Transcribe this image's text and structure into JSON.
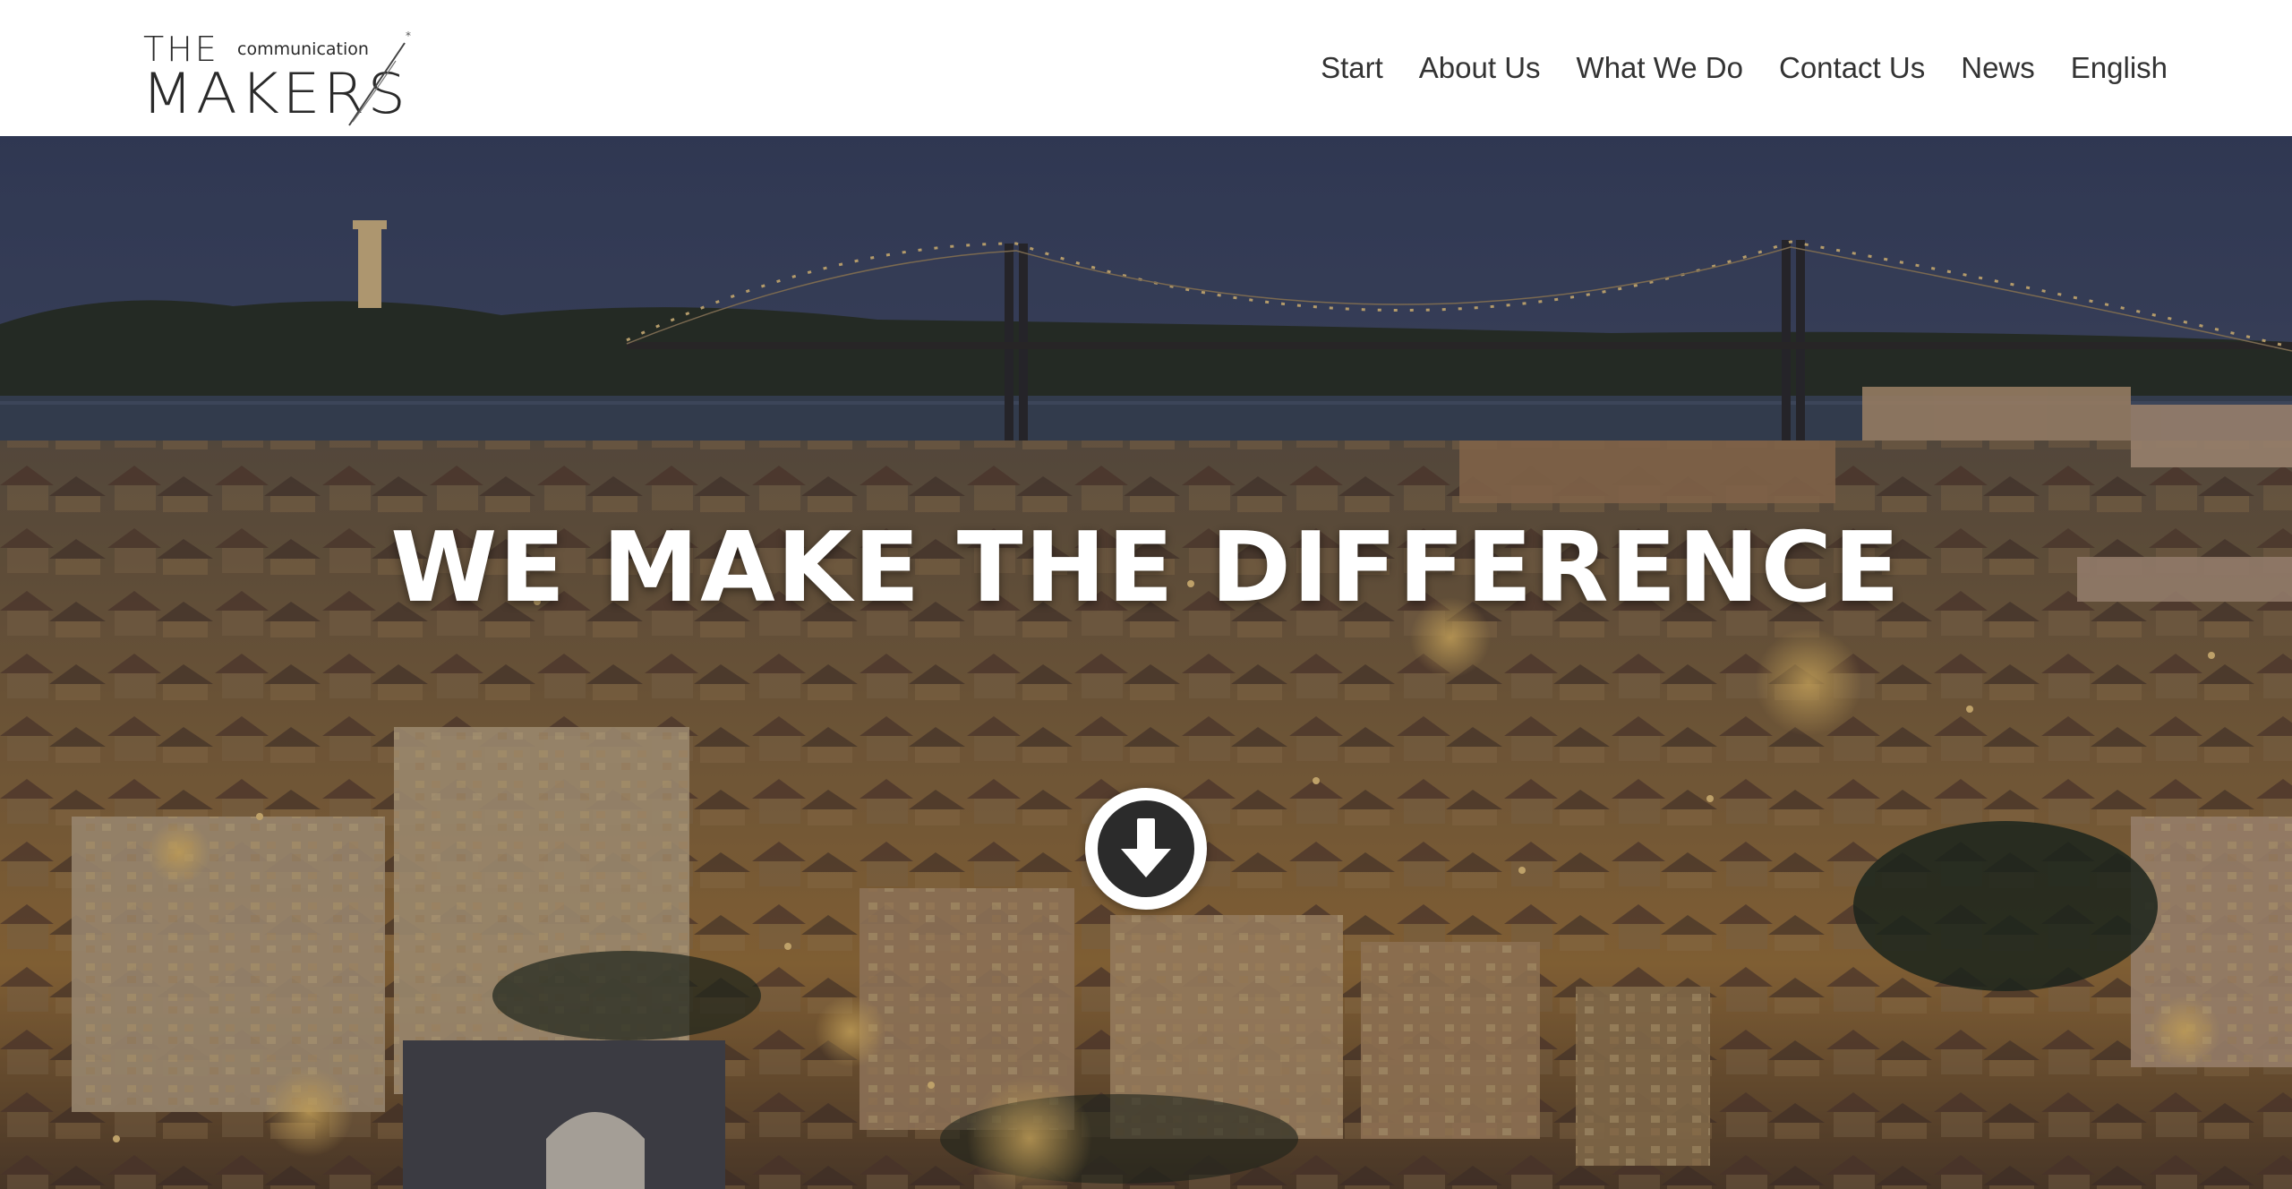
{
  "header": {
    "logo": {
      "word_top": "THE",
      "word_small": "communication",
      "word_main": "MAKERS",
      "mark": "*"
    },
    "nav": [
      {
        "label": "Start"
      },
      {
        "label": "About Us"
      },
      {
        "label": "What We Do"
      },
      {
        "label": "Contact Us"
      },
      {
        "label": "News"
      },
      {
        "label": "English"
      }
    ]
  },
  "hero": {
    "headline": "WE MAKE THE DIFFERENCE",
    "scroll_icon": "arrow-down-circle-icon"
  },
  "colors": {
    "header_bg": "#ffffff",
    "nav_text": "#333333",
    "headline": "#ffffff",
    "sky": "#38466a",
    "city_lights": "#e8a53c"
  }
}
